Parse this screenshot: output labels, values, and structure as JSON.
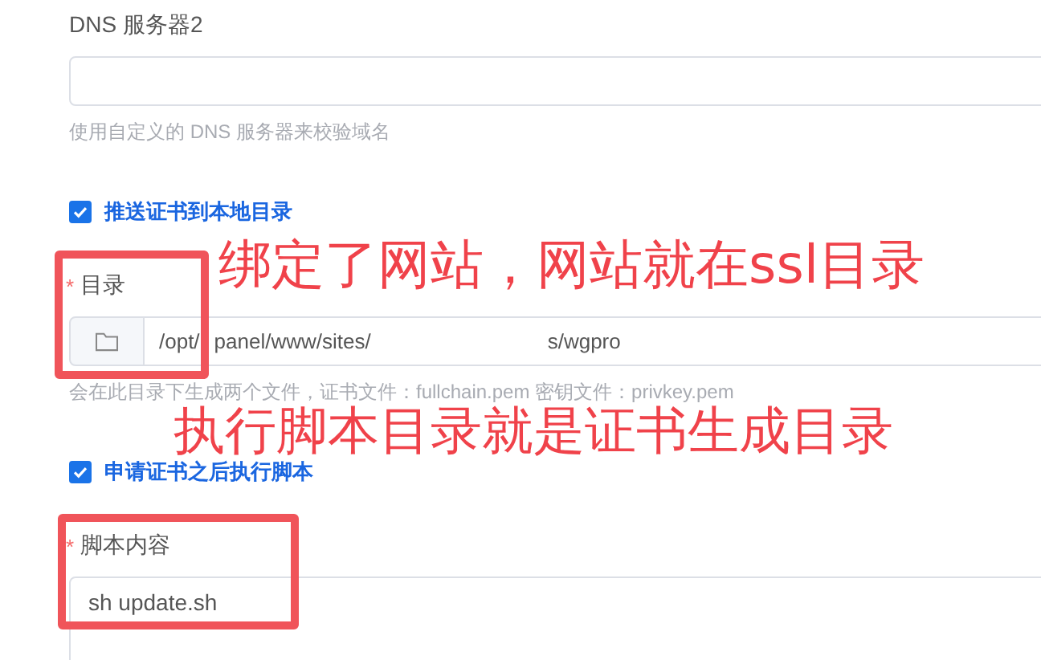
{
  "form": [
    {
      "kind": "input",
      "label": "DNS 服务器2",
      "hint": "使用自定义的 DNS 服务器来校验域名"
    },
    {
      "kind": "checkbox",
      "label": "推送证书到本地目录",
      "checked": true
    },
    {
      "kind": "path",
      "label": "目录",
      "required_mark": "*",
      "value_start": "/opt/",
      "value_middle": "panel/www/sites/",
      "value_end": "s/wgpro",
      "hint": "会在此目录下生成两个文件，证书文件：fullchain.pem 密钥文件：privkey.pem"
    },
    {
      "kind": "checkbox",
      "label": "申请证书之后执行脚本",
      "checked": true
    },
    {
      "kind": "textarea",
      "label": "脚本内容",
      "required_mark": "*",
      "value": "sh update.sh"
    }
  ],
  "annotations": [
    {
      "kind": "box"
    },
    {
      "kind": "text",
      "text": "绑定了网站，网站就在ssl目录"
    },
    {
      "kind": "text",
      "text": "执行脚本目录就是证书生成目录"
    },
    {
      "kind": "box"
    }
  ]
}
